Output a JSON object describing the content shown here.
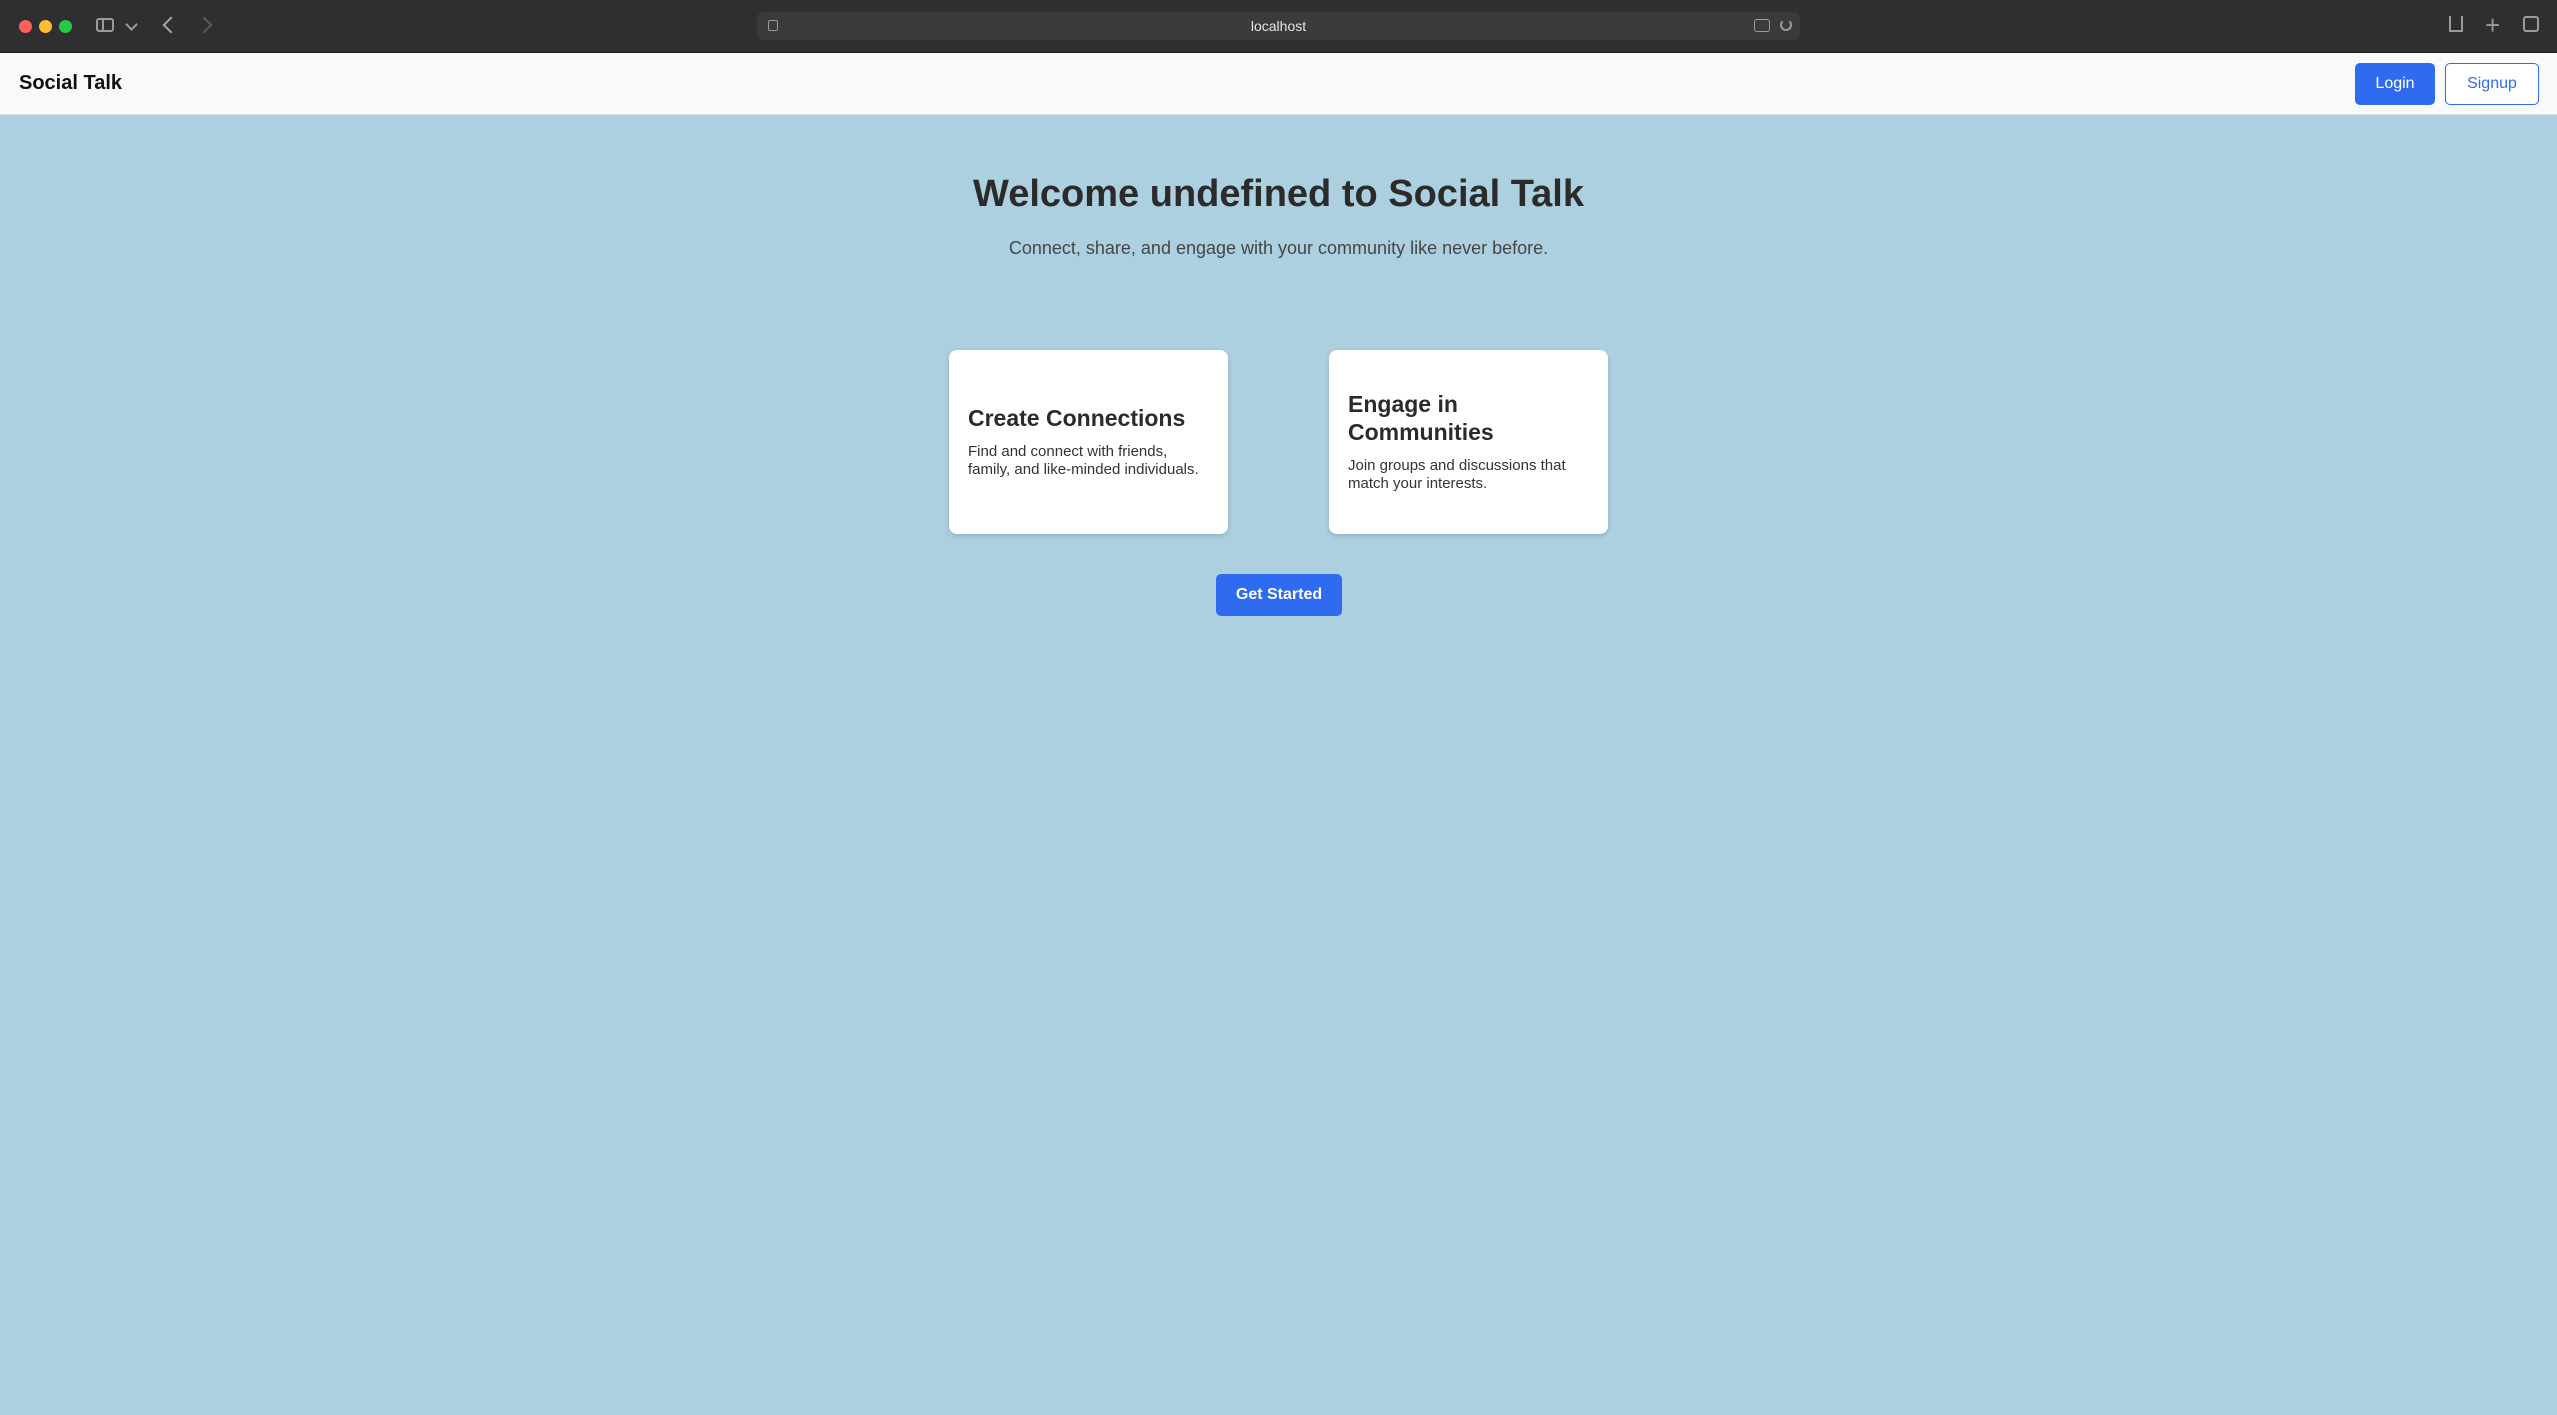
{
  "browser": {
    "url": "localhost"
  },
  "navbar": {
    "brand": "Social Talk",
    "login_label": "Login",
    "signup_label": "Signup"
  },
  "hero": {
    "title": "Welcome undefined to Social Talk",
    "subtitle": "Connect, share, and engage with your community like never before."
  },
  "features": [
    {
      "title": "Create Connections",
      "description": "Find and connect with friends, family, and like-minded individuals."
    },
    {
      "title": "Engage in Communities",
      "description": "Join groups and discussions that match your interests."
    }
  ],
  "cta": {
    "label": "Get Started"
  },
  "colors": {
    "background": "#add0e0",
    "primary": "#2f6bf0",
    "navbar": "#f8f9fa"
  }
}
